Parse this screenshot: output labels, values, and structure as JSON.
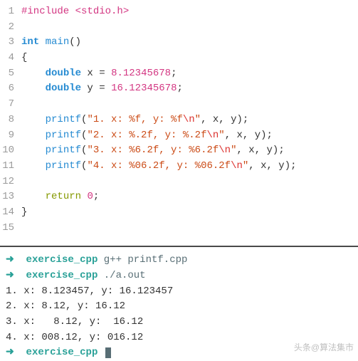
{
  "code": {
    "lines": [
      {
        "n": "1",
        "seg": [
          {
            "c": "preproc",
            "t": "#include <stdio.h>"
          }
        ]
      },
      {
        "n": "2",
        "seg": []
      },
      {
        "n": "3",
        "seg": [
          {
            "c": "kw-type",
            "t": "int"
          },
          {
            "c": "id",
            "t": " "
          },
          {
            "c": "fn",
            "t": "main"
          },
          {
            "c": "paren",
            "t": "()"
          }
        ]
      },
      {
        "n": "4",
        "seg": [
          {
            "c": "brace",
            "t": "{"
          }
        ]
      },
      {
        "n": "5",
        "seg": [
          {
            "c": "id",
            "t": "    "
          },
          {
            "c": "kw-type",
            "t": "double"
          },
          {
            "c": "id",
            "t": " x "
          },
          {
            "c": "op",
            "t": "="
          },
          {
            "c": "id",
            "t": " "
          },
          {
            "c": "num",
            "t": "8.12345678"
          },
          {
            "c": "semi",
            "t": ";"
          }
        ]
      },
      {
        "n": "6",
        "seg": [
          {
            "c": "id",
            "t": "    "
          },
          {
            "c": "kw-type",
            "t": "double"
          },
          {
            "c": "id",
            "t": " y "
          },
          {
            "c": "op",
            "t": "="
          },
          {
            "c": "id",
            "t": " "
          },
          {
            "c": "num",
            "t": "16.12345678"
          },
          {
            "c": "semi",
            "t": ";"
          }
        ]
      },
      {
        "n": "7",
        "seg": []
      },
      {
        "n": "8",
        "seg": [
          {
            "c": "id",
            "t": "    "
          },
          {
            "c": "fn",
            "t": "printf"
          },
          {
            "c": "paren",
            "t": "("
          },
          {
            "c": "str",
            "t": "\"1. x: %f, y: %f"
          },
          {
            "c": "escape",
            "t": "\\n"
          },
          {
            "c": "str",
            "t": "\""
          },
          {
            "c": "id",
            "t": ", x, y"
          },
          {
            "c": "paren",
            "t": ")"
          },
          {
            "c": "semi",
            "t": ";"
          }
        ]
      },
      {
        "n": "9",
        "seg": [
          {
            "c": "id",
            "t": "    "
          },
          {
            "c": "fn",
            "t": "printf"
          },
          {
            "c": "paren",
            "t": "("
          },
          {
            "c": "str",
            "t": "\"2. x: %.2f, y: %.2f"
          },
          {
            "c": "escape",
            "t": "\\n"
          },
          {
            "c": "str",
            "t": "\""
          },
          {
            "c": "id",
            "t": ", x, y"
          },
          {
            "c": "paren",
            "t": ")"
          },
          {
            "c": "semi",
            "t": ";"
          }
        ]
      },
      {
        "n": "10",
        "seg": [
          {
            "c": "id",
            "t": "    "
          },
          {
            "c": "fn",
            "t": "printf"
          },
          {
            "c": "paren",
            "t": "("
          },
          {
            "c": "str",
            "t": "\"3. x: %6.2f, y: %6.2f"
          },
          {
            "c": "escape",
            "t": "\\n"
          },
          {
            "c": "str",
            "t": "\""
          },
          {
            "c": "id",
            "t": ", x, y"
          },
          {
            "c": "paren",
            "t": ")"
          },
          {
            "c": "semi",
            "t": ";"
          }
        ]
      },
      {
        "n": "11",
        "seg": [
          {
            "c": "id",
            "t": "    "
          },
          {
            "c": "fn",
            "t": "printf"
          },
          {
            "c": "paren",
            "t": "("
          },
          {
            "c": "str",
            "t": "\"4. x: %06.2f, y: %06.2f"
          },
          {
            "c": "escape",
            "t": "\\n"
          },
          {
            "c": "str",
            "t": "\""
          },
          {
            "c": "id",
            "t": ", x, y"
          },
          {
            "c": "paren",
            "t": ")"
          },
          {
            "c": "semi",
            "t": ";"
          }
        ]
      },
      {
        "n": "12",
        "seg": []
      },
      {
        "n": "13",
        "seg": [
          {
            "c": "id",
            "t": "    "
          },
          {
            "c": "kw-return",
            "t": "return"
          },
          {
            "c": "id",
            "t": " "
          },
          {
            "c": "num",
            "t": "0"
          },
          {
            "c": "semi",
            "t": ";"
          }
        ]
      },
      {
        "n": "14",
        "seg": [
          {
            "c": "brace",
            "t": "}"
          }
        ]
      },
      {
        "n": "15",
        "seg": []
      }
    ]
  },
  "terminal": {
    "arrow": "➜",
    "dir": "exercise_cpp",
    "lines": [
      {
        "type": "prompt",
        "cmd": "g++ printf.cpp"
      },
      {
        "type": "prompt",
        "cmd": "./a.out"
      },
      {
        "type": "out",
        "t": "1. x: 8.123457, y: 16.123457"
      },
      {
        "type": "out",
        "t": "2. x: 8.12, y: 16.12"
      },
      {
        "type": "out",
        "t": "3. x:   8.12, y:  16.12"
      },
      {
        "type": "out",
        "t": "4. x: 008.12, y: 016.12"
      },
      {
        "type": "prompt",
        "cmd": ""
      }
    ]
  },
  "watermark": "头条@算法集市"
}
